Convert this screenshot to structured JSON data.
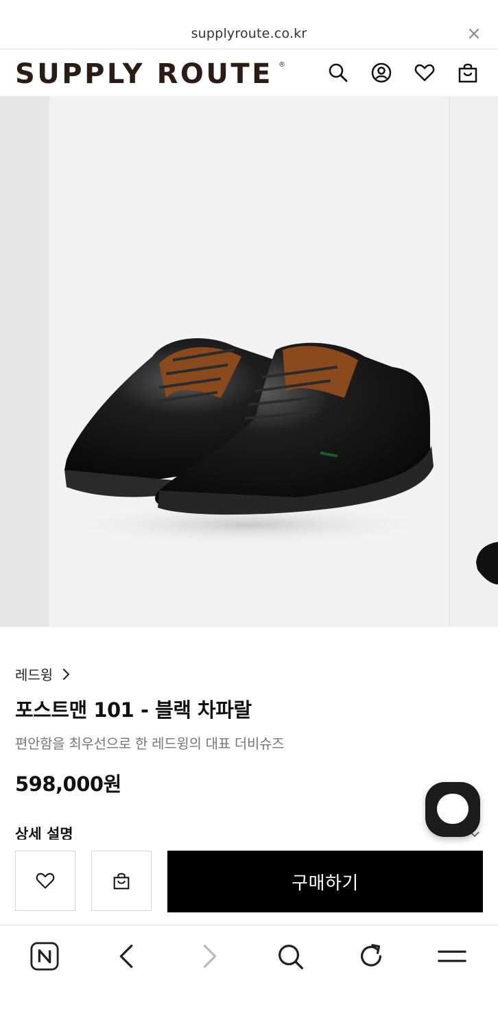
{
  "browser": {
    "url": "supplyroute.co.kr"
  },
  "header": {
    "logo_text": "SUPPLY ROUTE",
    "logo_mark": "®",
    "icons": [
      "search-icon",
      "account-icon",
      "heart-icon",
      "shopping-bag-icon"
    ]
  },
  "product": {
    "brand": "레드윙",
    "title": "포스트맨 101 - 블랙 차파랄",
    "subtitle": "편안함을 최우선으로 한 레드윙의 대표 더비슈즈",
    "price": "598,000원",
    "detail_section_label": "상세 설명"
  },
  "buy_bar": {
    "buy_label": "구매하기"
  },
  "bottom_nav": {
    "icons": [
      "naver-home-icon",
      "back-icon",
      "forward-icon",
      "search-icon",
      "refresh-icon",
      "menu-icon"
    ]
  },
  "colors": {
    "brand": "#2b1d16",
    "buy_button": "#000000",
    "gallery_bg": "#f2f2f2"
  }
}
